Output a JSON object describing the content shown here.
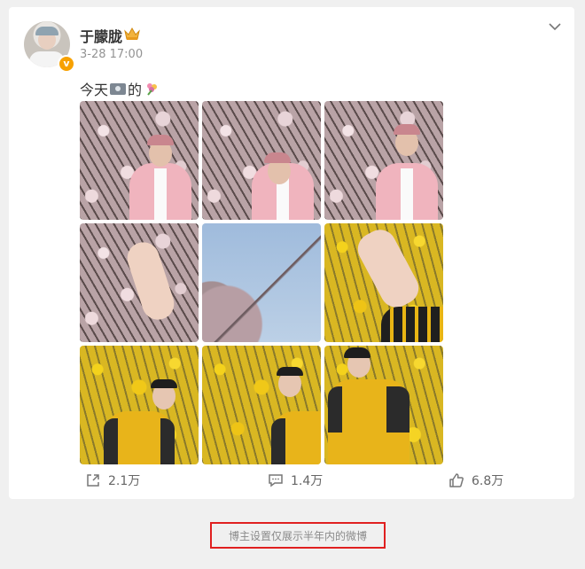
{
  "post": {
    "username": "于朦胧",
    "timestamp": "3-28 17:00",
    "text_before": "今天",
    "text_after": "的",
    "icons": [
      "avatar",
      "verified-badge",
      "crown-icon",
      "chevron-down-icon",
      "camera-emoji",
      "flower-emoji"
    ],
    "verified_label": "v"
  },
  "actions": {
    "share_count": "2.1万",
    "comment_count": "1.4万",
    "like_count": "6.8万"
  },
  "footer": {
    "notice": "博主设置仅展示半年内的微博"
  },
  "colors": {
    "accent_verified": "#f7a100",
    "notice_border": "#e02020"
  }
}
